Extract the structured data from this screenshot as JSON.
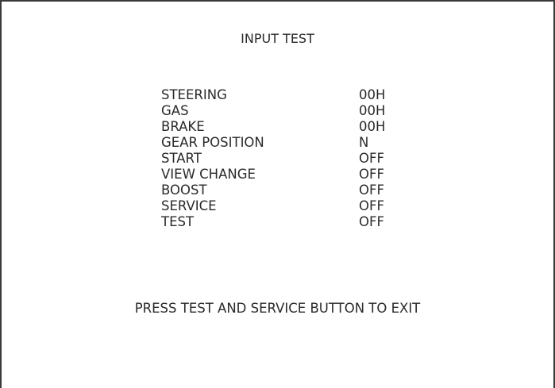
{
  "screen": {
    "title": "INPUT TEST",
    "rows": [
      {
        "label": "STEERING",
        "value": "00H"
      },
      {
        "label": "GAS",
        "value": "00H"
      },
      {
        "label": "BRAKE",
        "value": "00H"
      },
      {
        "label": "GEAR POSITION",
        "value": "N"
      },
      {
        "label": "START",
        "value": "OFF"
      },
      {
        "label": "VIEW CHANGE",
        "value": "OFF"
      },
      {
        "label": "BOOST",
        "value": "OFF"
      },
      {
        "label": "SERVICE",
        "value": "OFF"
      },
      {
        "label": "TEST",
        "value": "OFF"
      }
    ],
    "footer": "PRESS TEST AND SERVICE BUTTON TO EXIT"
  },
  "colors": {
    "background": "#ffffff",
    "text": "#2a2a2a",
    "border": "#3a3a3a"
  }
}
